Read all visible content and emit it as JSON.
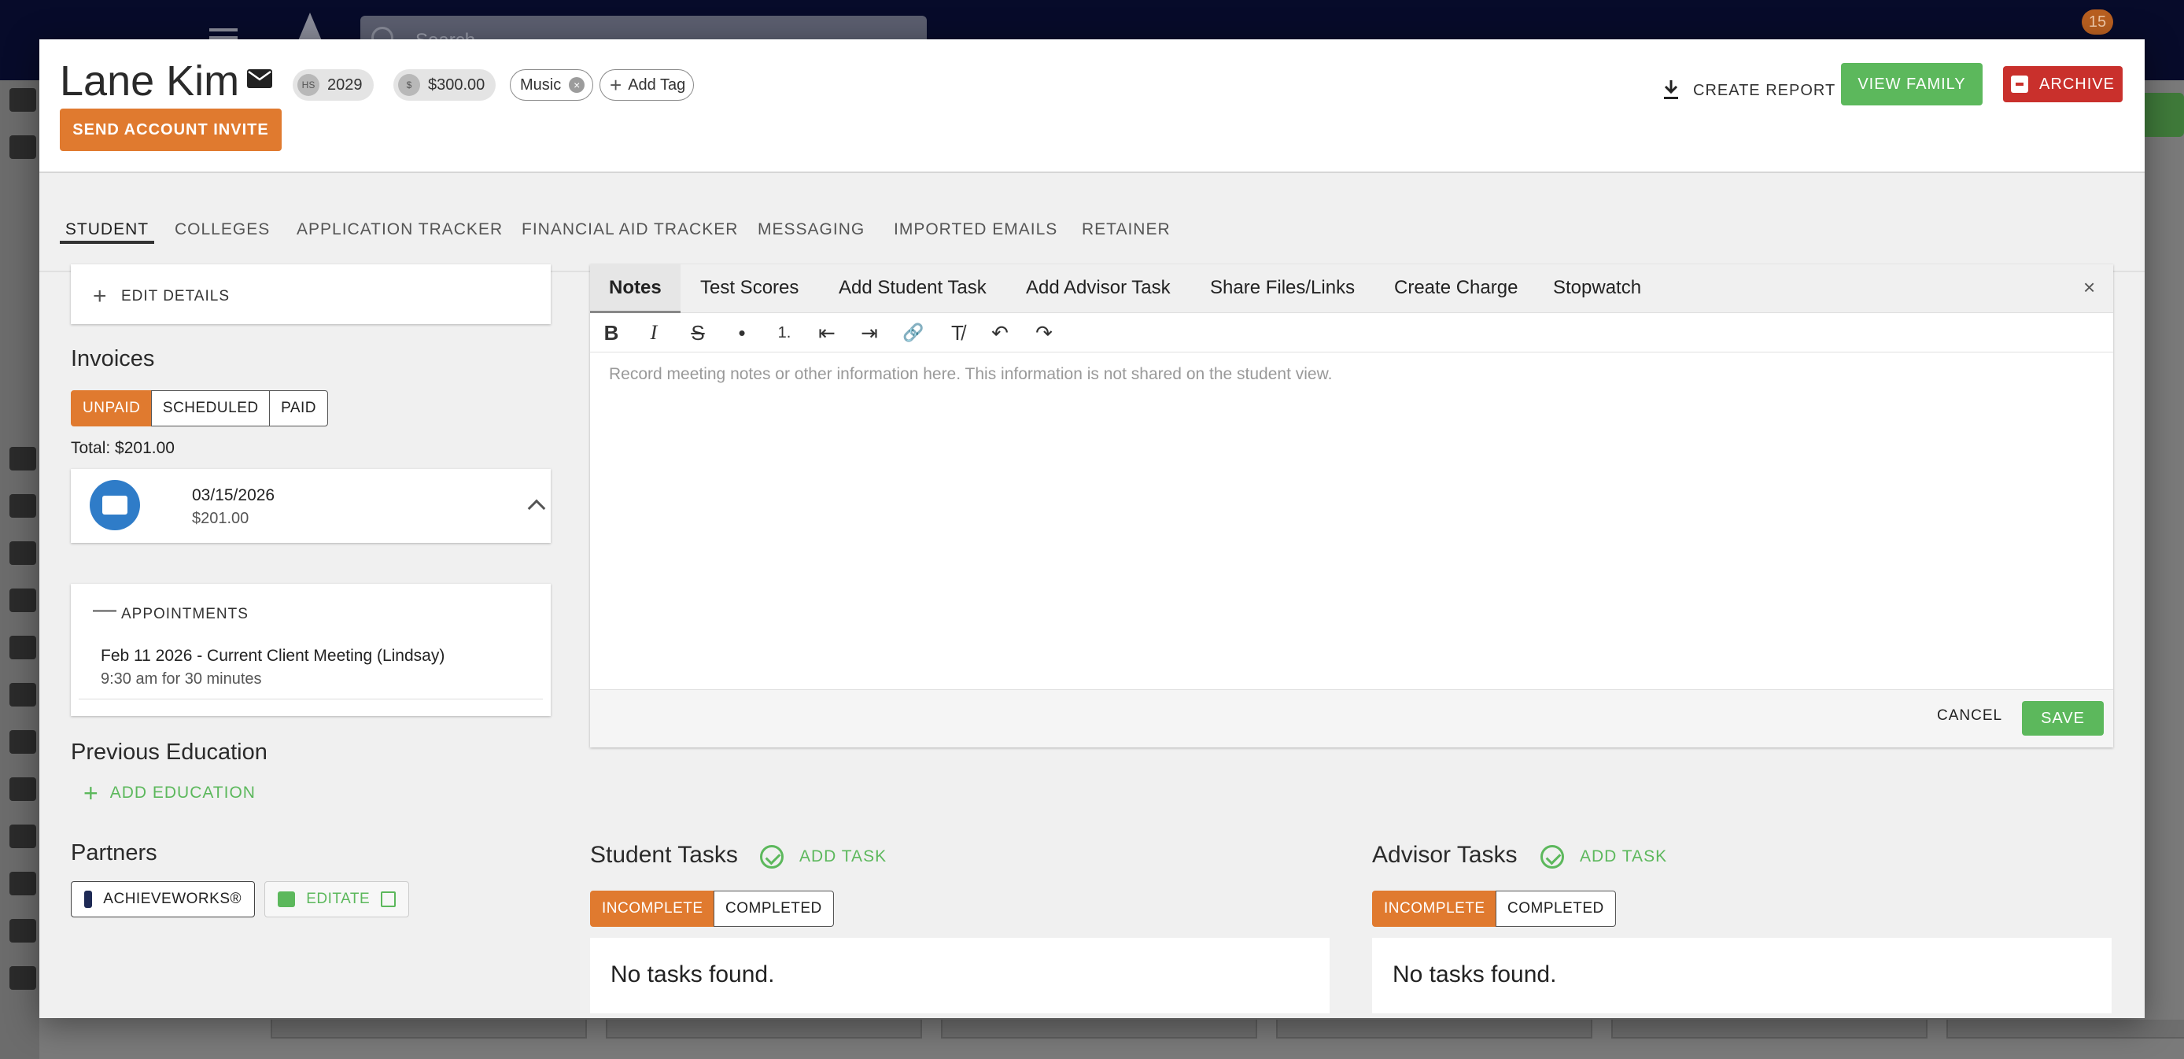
{
  "background": {
    "search_placeholder": "Search",
    "notification_count": "15"
  },
  "header": {
    "student_name": "Lane Kim",
    "chips": {
      "grad_icon": "HS",
      "grad_year": "2029",
      "balance_icon": "$",
      "balance": "$300.00",
      "tag": "Music",
      "add_tag": "Add Tag"
    },
    "send_invite": "SEND ACCOUNT INVITE",
    "create_report": "CREATE REPORT",
    "view_family": "VIEW FAMILY",
    "archive": "ARCHIVE"
  },
  "tabs": [
    "STUDENT",
    "COLLEGES",
    "APPLICATION TRACKER",
    "FINANCIAL AID TRACKER",
    "MESSAGING",
    "IMPORTED EMAILS",
    "RETAINER"
  ],
  "left": {
    "edit_details": "EDIT DETAILS",
    "invoices_title": "Invoices",
    "invoice_filters": [
      "UNPAID",
      "SCHEDULED",
      "PAID"
    ],
    "total": "Total: $201.00",
    "invoice": {
      "date": "03/15/2026",
      "amount": "$201.00"
    },
    "appointments_label": "APPOINTMENTS",
    "appointment": {
      "title": "Feb 11 2026 - Current Client Meeting (Lindsay)",
      "time": "9:30 am for 30 minutes"
    },
    "previous_education_title": "Previous Education",
    "add_education": "ADD EDUCATION",
    "partners_title": "Partners",
    "partners": [
      "ACHIEVEWORKS®",
      "EDITATE"
    ]
  },
  "notes": {
    "tabs": [
      "Notes",
      "Test Scores",
      "Add Student Task",
      "Add Advisor Task",
      "Share Files/Links",
      "Create Charge",
      "Stopwatch"
    ],
    "close": "×",
    "toolbar": [
      "B",
      "I",
      "S",
      "•",
      "1.",
      "⇤",
      "⇥",
      "🔗",
      "T̸",
      "↶",
      "↷"
    ],
    "placeholder": "Record meeting notes or other information here. This information is not shared on the student view.",
    "cancel": "CANCEL",
    "save": "SAVE"
  },
  "student_tasks": {
    "title": "Student Tasks",
    "add": "ADD TASK",
    "filters": [
      "INCOMPLETE",
      "COMPLETED"
    ],
    "empty": "No tasks found."
  },
  "advisor_tasks": {
    "title": "Advisor Tasks",
    "add": "ADD TASK",
    "filters": [
      "INCOMPLETE",
      "COMPLETED"
    ],
    "empty": "No tasks found."
  },
  "colors": {
    "accent_orange": "#e07a2f",
    "success_green": "#5cb85c",
    "danger_red": "#c9302c",
    "topbar": "#070b2a"
  }
}
